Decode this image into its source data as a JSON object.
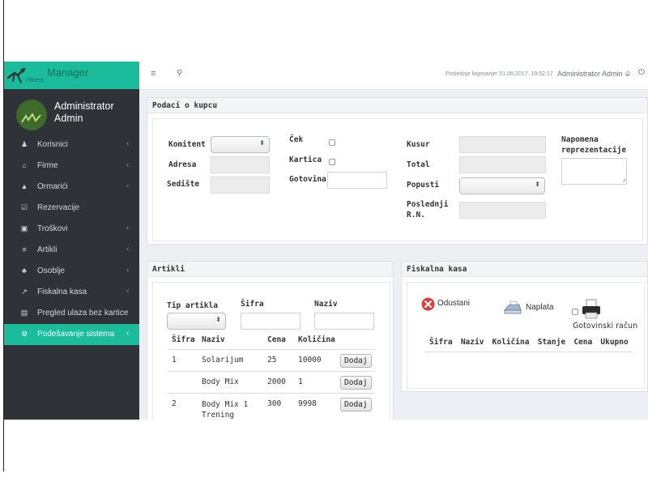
{
  "brand": {
    "title": "Manager",
    "subtitle": "Fitness"
  },
  "user": {
    "name": "Administrator Admin"
  },
  "sidebar": {
    "items": [
      {
        "label": "Korisnici",
        "icon": "user-icon",
        "glyph": "♟",
        "chevron": "‹"
      },
      {
        "label": "Firme",
        "icon": "institution-icon",
        "glyph": "⌂",
        "chevron": "‹"
      },
      {
        "label": "Ormarići",
        "icon": "lock-icon",
        "glyph": "▲",
        "chevron": "‹"
      },
      {
        "label": "Rezervacije",
        "icon": "check-square-icon",
        "glyph": "☑",
        "chevron": ""
      },
      {
        "label": "Troškovi",
        "icon": "money-icon",
        "glyph": "▣",
        "chevron": "‹"
      },
      {
        "label": "Artikli",
        "icon": "cart-icon",
        "glyph": "≡",
        "chevron": "‹"
      },
      {
        "label": "Osoblje",
        "icon": "users-icon",
        "glyph": "♣",
        "chevron": "‹"
      },
      {
        "label": "Fiskalna kasa",
        "icon": "line-chart-icon",
        "glyph": "↗",
        "chevron": "‹"
      },
      {
        "label": "Pregled ulaza bez kartice",
        "icon": "file-icon",
        "glyph": "▤",
        "chevron": ""
      },
      {
        "label": "Podešavanje sistema",
        "icon": "cogs-icon",
        "glyph": "⚙",
        "chevron": "‹",
        "active": true
      }
    ]
  },
  "topbar": {
    "last_login": "Poslednje logovanje: 01.08.2017. 19:52:17",
    "user_menu": "Administrator Admin",
    "user_menu_caret": "⌄",
    "menu_glyph": "≡",
    "search_glyph": "⚲",
    "home_glyph": "⌂",
    "power_glyph": "⏻"
  },
  "kupac": {
    "title": "Podaci o kupcu",
    "komitent_label": "Komitent",
    "adresa_label": "Adresa",
    "sediste_label": "Sedište",
    "cek_label": "Ček",
    "kartica_label": "Kartica",
    "gotovina_label": "Gotovina",
    "kusur_label": "Kusur",
    "total_label": "Total",
    "popusti_label": "Popusti",
    "poslednji_label": "Poslednji R.N.",
    "napomena_label": "Napomena reprezentacije",
    "select_arrow": "⬍",
    "resize_glyph": "⁄⁄"
  },
  "artikli": {
    "title": "Artikli",
    "tip_label": "Tip artikla",
    "sifra_label": "Šifra",
    "naziv_label": "Naziv",
    "columns": [
      "Šifra",
      "Naziv",
      "Cena",
      "Količina",
      ""
    ],
    "rows": [
      {
        "sifra": "1",
        "naziv": "Solarijum",
        "cena": "25",
        "kolicina": "10000",
        "action": "Dodaj"
      },
      {
        "sifra": "",
        "naziv": "Body Mix",
        "cena": "2000",
        "kolicina": "1",
        "action": "Dodaj"
      },
      {
        "sifra": "2",
        "naziv": "Body Mix 1 Trening",
        "cena": "300",
        "kolicina": "9998",
        "action": "Dodaj"
      }
    ]
  },
  "fiskalna": {
    "title": "Fiskalna kasa",
    "odustani": "Odustani",
    "naplata": "Naplata",
    "gotovinski": "Gotovinski račun",
    "columns": [
      "Šifra",
      "Naziv",
      "Količina",
      "Stanje",
      "Cena",
      "Ukupno"
    ]
  }
}
